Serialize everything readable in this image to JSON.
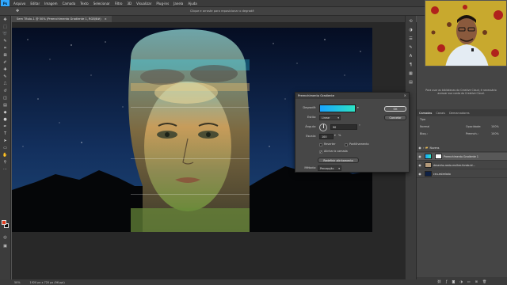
{
  "menubar": {
    "logo": "Ps",
    "items": [
      "Arquivo",
      "Editar",
      "Imagem",
      "Camada",
      "Texto",
      "Selecionar",
      "Filtro",
      "3D",
      "Visualizar",
      "Plug-ins",
      "Janela",
      "Ajuda"
    ]
  },
  "optbar": {
    "hint": "Clique e arraste para reposicionar o degradê"
  },
  "document": {
    "tab_title": "Sem Título-1 @ 50% (Preenchimento Gradiente 1, RGB/8#)",
    "tab_close": "×",
    "zoom": "50%",
    "doc_info": "1920 px x 720 px (96 ppi)"
  },
  "dialog": {
    "title": "Preenchimento Gradiente",
    "gradient_label": "Degradê:",
    "style_label": "Estilo:",
    "style_value": "Linear",
    "angle_label": "Ângulo:",
    "angle_value": "90",
    "scale_label": "Escala:",
    "scale_value": "100",
    "scale_unit": "%",
    "reverse_label": "Reverter",
    "dither_label": "Pontilhamento",
    "align_label": "Alinhar à camada",
    "reset_label": "Redefinir alinhamento",
    "method_label": "Método:",
    "method_value": "Percepção",
    "ok_label": "OK",
    "cancel_label": "Cancelar",
    "reverse_checked": false,
    "dither_checked": false,
    "align_checked": true
  },
  "cc_message": "Para usar as bibliotecas da Creative Cloud, é necessário acessar sua conta do Creative Cloud.",
  "panels": {
    "tabs": [
      "Camadas",
      "Canais",
      "Demarcadores"
    ],
    "mode": "Normal",
    "opacity_label": "Opacidade:",
    "opacity_value": "100%",
    "fill_label": "Preench.:",
    "fill_value": "100%",
    "lock_label": "Bloq.:",
    "filter_label": "Tipo"
  },
  "layers": [
    {
      "name": "Nuvens",
      "type": "folder"
    },
    {
      "name": "Preenchimento Gradiente 1",
      "type": "fill"
    },
    {
      "name": "desenho-rosto-mulher-fundo-bl...",
      "type": "image"
    },
    {
      "name": "ceu-estrelado",
      "type": "image"
    }
  ]
}
